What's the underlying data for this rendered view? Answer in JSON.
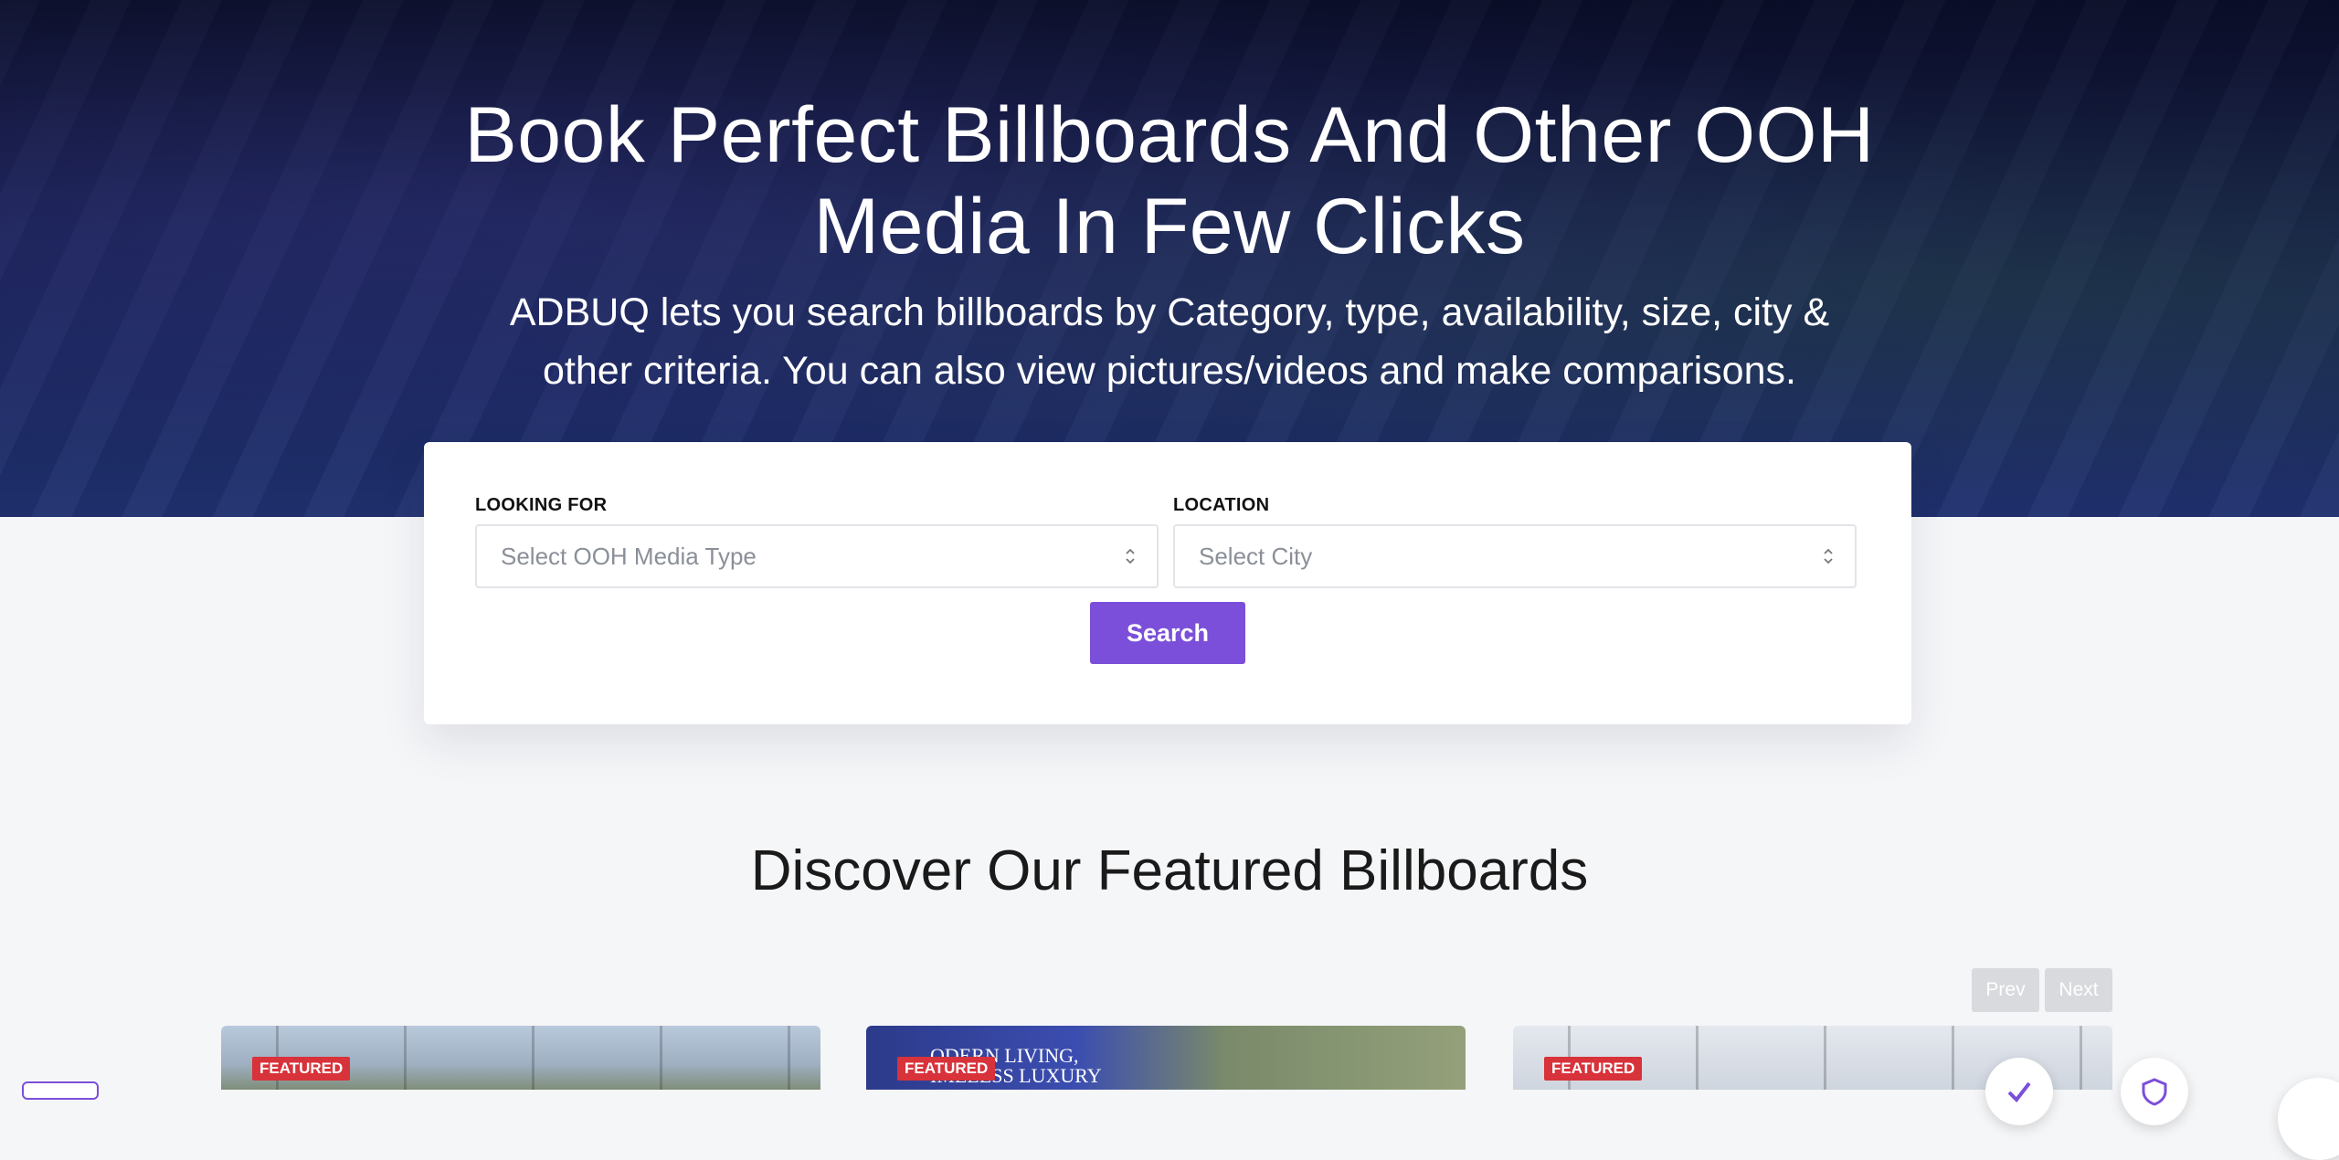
{
  "hero": {
    "title_line1": "Book Perfect Billboards And Other OOH",
    "title_line2": "Media In Few Clicks",
    "subtitle_line1": "ADBUQ lets you search billboards by Category, type, availability, size, city &",
    "subtitle_line2": "other criteria. You can also view pictures/videos and make comparisons."
  },
  "search": {
    "looking_for_label": "LOOKING FOR",
    "media_type_placeholder": "Select OOH Media Type",
    "location_label": "LOCATION",
    "city_placeholder": "Select City",
    "button_label": "Search"
  },
  "featured": {
    "title": "Discover Our Featured Billboards",
    "prev_label": "Prev",
    "next_label": "Next",
    "cards": [
      {
        "badge": "FEATURED"
      },
      {
        "badge": "FEATURED",
        "poster_text_line1": "ODERN LIVING,",
        "poster_text_line2": "IMELESS LUXURY"
      },
      {
        "badge": "FEATURED"
      }
    ]
  },
  "colors": {
    "accent": "#7b4fd9",
    "badge": "#d8323a",
    "page_bg": "#f5f6f8"
  },
  "icons": [
    "chevron-updown-icon",
    "check-icon",
    "shield-icon"
  ]
}
